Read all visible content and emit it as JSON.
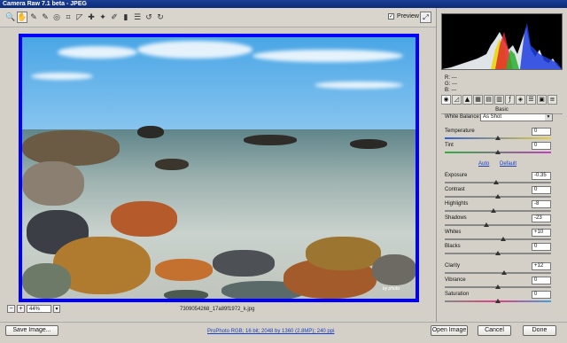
{
  "window": {
    "title": "Camera Raw 7.1 beta  -  JPEG"
  },
  "toolbar": {
    "tools": [
      {
        "name": "zoom-tool-icon",
        "glyph": "🔍"
      },
      {
        "name": "hand-tool-icon",
        "glyph": "✋"
      },
      {
        "name": "white-balance-tool-icon",
        "glyph": "✎"
      },
      {
        "name": "color-sampler-tool-icon",
        "glyph": "✎"
      },
      {
        "name": "target-adjustment-tool-icon",
        "glyph": "◎"
      },
      {
        "name": "crop-tool-icon",
        "glyph": "⌗"
      },
      {
        "name": "straighten-tool-icon",
        "glyph": "◸"
      },
      {
        "name": "spot-removal-tool-icon",
        "glyph": "✚"
      },
      {
        "name": "red-eye-tool-icon",
        "glyph": "✦"
      },
      {
        "name": "adjustment-brush-icon",
        "glyph": "✐"
      },
      {
        "name": "graduated-filter-icon",
        "glyph": "▮"
      },
      {
        "name": "preferences-icon",
        "glyph": "☰"
      },
      {
        "name": "rotate-ccw-icon",
        "glyph": "↺"
      },
      {
        "name": "rotate-cw-icon",
        "glyph": "↻"
      }
    ],
    "preview_label": "Preview",
    "preview_checked": "✓"
  },
  "image": {
    "filename": "7309054268_17a89f1972_k.jpg",
    "zoom": "44%"
  },
  "readout": {
    "r": "R:   ---",
    "g": "G:   ---",
    "b": "B:   ---"
  },
  "panel": {
    "title": "Basic",
    "white_balance_label": "White Balance:",
    "white_balance_value": "As Shot",
    "auto_label": "Auto",
    "default_label": "Default",
    "sliders": [
      {
        "label": "Temperature",
        "value": "0",
        "pos": 0.5
      },
      {
        "label": "Tint",
        "value": "0",
        "pos": 0.5
      },
      {
        "label": "Exposure",
        "value": "-0.35",
        "pos": 0.48
      },
      {
        "label": "Contrast",
        "value": "0",
        "pos": 0.5
      },
      {
        "label": "Highlights",
        "value": "-8",
        "pos": 0.46
      },
      {
        "label": "Shadows",
        "value": "-23",
        "pos": 0.39
      },
      {
        "label": "Whites",
        "value": "+10",
        "pos": 0.55
      },
      {
        "label": "Blacks",
        "value": "0",
        "pos": 0.5
      },
      {
        "label": "Clarity",
        "value": "+12",
        "pos": 0.56
      },
      {
        "label": "Vibrance",
        "value": "0",
        "pos": 0.5
      },
      {
        "label": "Saturation",
        "value": "0",
        "pos": 0.5
      }
    ]
  },
  "footer": {
    "save_label": "Save Image...",
    "workflow": "ProPhoto RGB; 16 bit; 2048 by 1360 (2.8MP); 240 ppi",
    "open_label": "Open Image",
    "cancel_label": "Cancel",
    "done_label": "Done"
  }
}
